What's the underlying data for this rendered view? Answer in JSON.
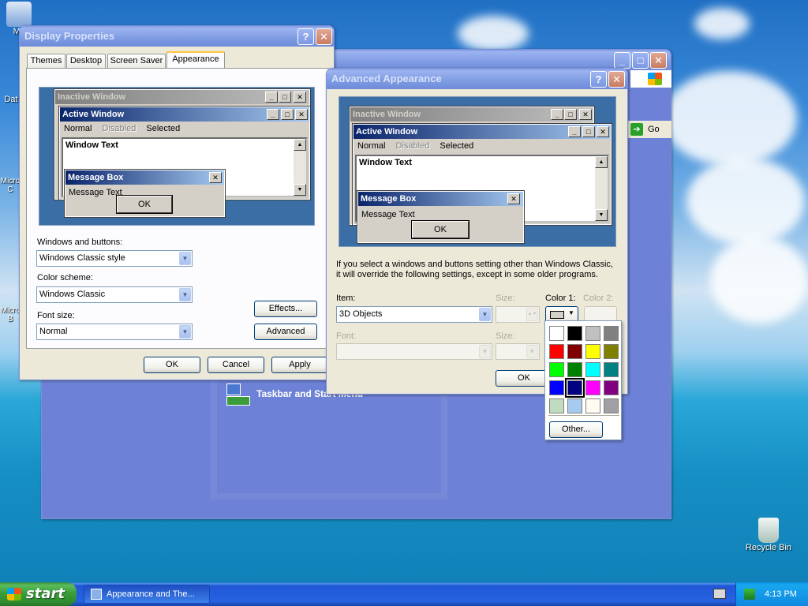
{
  "desktop": {
    "icons": [
      {
        "label": "My"
      },
      {
        "label": "Dat"
      },
      {
        "label": "Micro\nC"
      },
      {
        "label": "Micro\nB"
      },
      {
        "label": "Recycle Bin"
      }
    ]
  },
  "bg_window": {
    "go_label": "Go",
    "taskbar_link": "Taskbar and Start Menu"
  },
  "display_properties": {
    "title": "Display Properties",
    "tabs": [
      "Themes",
      "Desktop",
      "Screen Saver",
      "Appearance"
    ],
    "preview": {
      "inactive_title": "Inactive Window",
      "active_title": "Active Window",
      "menu": [
        "Normal",
        "Disabled",
        "Selected"
      ],
      "window_text": "Window Text",
      "msgbox_title": "Message Box",
      "msgbox_text": "Message Text",
      "ok": "OK"
    },
    "windows_buttons_label": "Windows and buttons:",
    "windows_buttons_value": "Windows Classic style",
    "color_scheme_label": "Color scheme:",
    "color_scheme_value": "Windows Classic",
    "font_size_label": "Font size:",
    "font_size_value": "Normal",
    "effects_button": "Effects...",
    "advanced_button": "Advanced",
    "ok_button": "OK",
    "cancel_button": "Cancel",
    "apply_button": "Apply"
  },
  "advanced_appearance": {
    "title": "Advanced Appearance",
    "preview": {
      "inactive_title": "Inactive Window",
      "active_title": "Active Window",
      "menu": [
        "Normal",
        "Disabled",
        "Selected"
      ],
      "window_text": "Window Text",
      "msgbox_title": "Message Box",
      "msgbox_text": "Message Text",
      "ok": "OK"
    },
    "info_line1": "If you select a windows and buttons setting other than Windows Classic,",
    "info_line2": "it will override the following settings, except in some older programs.",
    "item_label": "Item:",
    "item_value": "3D Objects",
    "size_label": "Size:",
    "color1_label": "Color 1:",
    "color2_label": "Color 2:",
    "font_label": "Font:",
    "size2_label": "Size:",
    "ok_button": "OK"
  },
  "color_popup": {
    "swatches": [
      "#ffffff",
      "#000000",
      "#c0c0c0",
      "#808080",
      "#ff0000",
      "#800000",
      "#ffff00",
      "#808000",
      "#00ff00",
      "#008000",
      "#00ffff",
      "#008080",
      "#0000ff",
      "#000080",
      "#ff00ff",
      "#800080",
      "#c0dcc0",
      "#a6caf0",
      "#fffbf0",
      "#a0a0a4"
    ],
    "selected_index": 13,
    "other_button": "Other..."
  },
  "taskbar": {
    "start_label": "start",
    "task_label": "Appearance and The...",
    "clock": "4:13 PM"
  }
}
